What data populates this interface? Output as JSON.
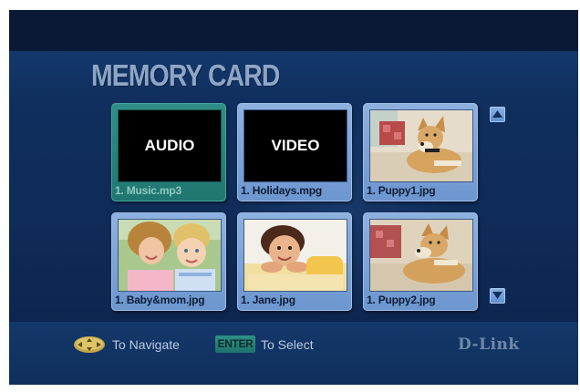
{
  "header": {
    "title": "MEMORY CARD"
  },
  "grid": {
    "items": [
      {
        "kind": "audio",
        "thumb_label": "AUDIO",
        "caption": "1. Music.mp3",
        "selected": true
      },
      {
        "kind": "video",
        "thumb_label": "VIDEO",
        "caption": "1. Holidays.mpg",
        "selected": false
      },
      {
        "kind": "photo-dog",
        "caption": "1. Puppy1.jpg",
        "selected": false
      },
      {
        "kind": "photo-mom-baby",
        "caption": "1. Baby&mom.jpg",
        "selected": false
      },
      {
        "kind": "photo-girl",
        "caption": "1. Jane.jpg",
        "selected": false
      },
      {
        "kind": "photo-dog",
        "caption": "1. Puppy2.jpg",
        "selected": false
      }
    ]
  },
  "scroll": {
    "up_icon": "arrow-up-icon",
    "down_icon": "arrow-down-icon"
  },
  "footer": {
    "nav_icon": "dpad-icon",
    "navigate_text": "To Navigate",
    "enter_key_label": "ENTER",
    "select_text": "To Select",
    "brand": "D-Link"
  },
  "colors": {
    "background": "#0b1c3a",
    "band": "#102f5e",
    "tile": "#7fa5d8",
    "tile_selected": "#2a8a80",
    "title_text": "#8ea6c6",
    "footer_text": "#b9cbe2"
  }
}
